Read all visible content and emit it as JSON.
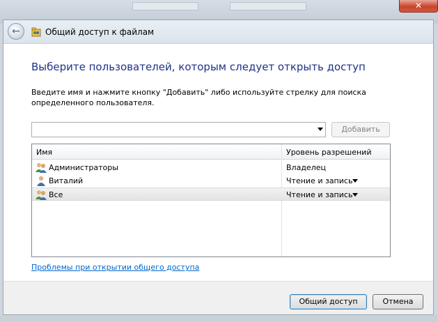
{
  "window": {
    "title": "Общий доступ к файлам",
    "close_label": "✕"
  },
  "main": {
    "heading": "Выберите пользователей, которым следует открыть доступ",
    "description": "Введите имя и нажмите кнопку \"Добавить\" либо используйте стрелку для поиска определенного пользователя.",
    "user_input_value": "",
    "add_button_label": "Добавить"
  },
  "list": {
    "columns": [
      "Имя",
      "Уровень разрешений"
    ],
    "rows": [
      {
        "name": "Администраторы",
        "permission": "Владелец",
        "icon": "group-icon",
        "has_dropdown": false,
        "selected": false
      },
      {
        "name": "Виталий",
        "permission": "Чтение и запись",
        "icon": "user-icon",
        "has_dropdown": true,
        "selected": false
      },
      {
        "name": "Все",
        "permission": "Чтение и запись",
        "icon": "group-icon",
        "has_dropdown": true,
        "selected": true
      }
    ]
  },
  "help_link": "Проблемы при открытии общего доступа",
  "footer": {
    "share_label": "Общий доступ",
    "cancel_label": "Отмена"
  },
  "colors": {
    "heading": "#1e3287",
    "link": "#0066cc",
    "close": "#c8452c"
  }
}
